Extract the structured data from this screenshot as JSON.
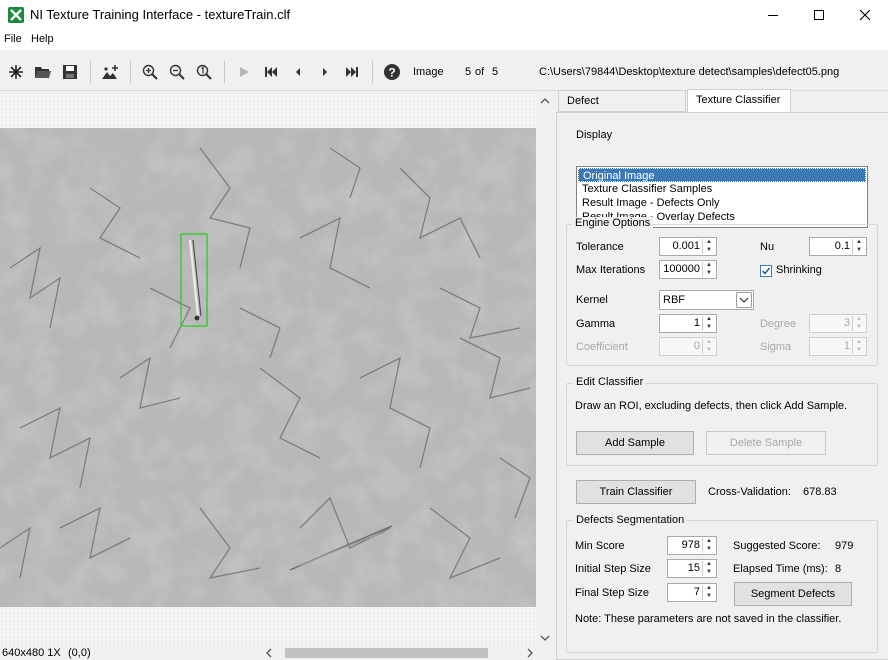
{
  "window": {
    "title": "NI Texture Training Interface - textureTrain.clf"
  },
  "menu": {
    "file": "File",
    "help": "Help"
  },
  "toolbar": {
    "image_label": "Image",
    "image_index": "5",
    "of_label": "of",
    "image_count": "5",
    "path": "C:\\Users\\79844\\Desktop\\texture detect\\samples\\defect05.png"
  },
  "tabs": [
    "Defect Characterization",
    "Texture Classifier"
  ],
  "display": {
    "title": "Display",
    "options": [
      "Original Image",
      "Texture Classifier Samples",
      "Result Image - Defects Only",
      "Result Image - Overlay Defects"
    ],
    "selected": "Original Image"
  },
  "engine": {
    "title": "Engine Options",
    "tolerance_label": "Tolerance",
    "tolerance": "0.001",
    "nu_label": "Nu",
    "nu": "0.1",
    "max_iter_label": "Max Iterations",
    "max_iter": "100000",
    "shrinking_label": "Shrinking",
    "shrinking_checked": true,
    "kernel_label": "Kernel",
    "kernel": "RBF",
    "gamma_label": "Gamma",
    "gamma": "1",
    "degree_label": "Degree",
    "degree": "3",
    "coefficient_label": "Coefficient",
    "coefficient": "0",
    "sigma_label": "Sigma",
    "sigma": "1"
  },
  "edit": {
    "title": "Edit Classifier",
    "instruction": "Draw an ROI, excluding defects, then click Add Sample.",
    "add_label": "Add  Sample",
    "delete_label": "Delete Sample"
  },
  "train": {
    "button": "Train Classifier",
    "cv_label": "Cross-Validation:",
    "cv_value": "678.83"
  },
  "segmentation": {
    "title": "Defects Segmentation",
    "min_score_label": "Min Score",
    "min_score": "978",
    "suggested_label": "Suggested Score:",
    "suggested": "979",
    "initial_step_label": "Initial Step Size",
    "initial_step": "15",
    "elapsed_label": "Elapsed Time (ms):",
    "elapsed": "8",
    "final_step_label": "Final Step Size",
    "final_step": "7",
    "segment_button": "Segment Defects",
    "note": "Note: These parameters are not saved in the classifier."
  },
  "status": {
    "size": "640x480 1X",
    "coords": "(0,0)"
  },
  "colors": {
    "selection": "#3b78b5",
    "roi": "#22cc22",
    "brand": "#1b8a3a"
  }
}
